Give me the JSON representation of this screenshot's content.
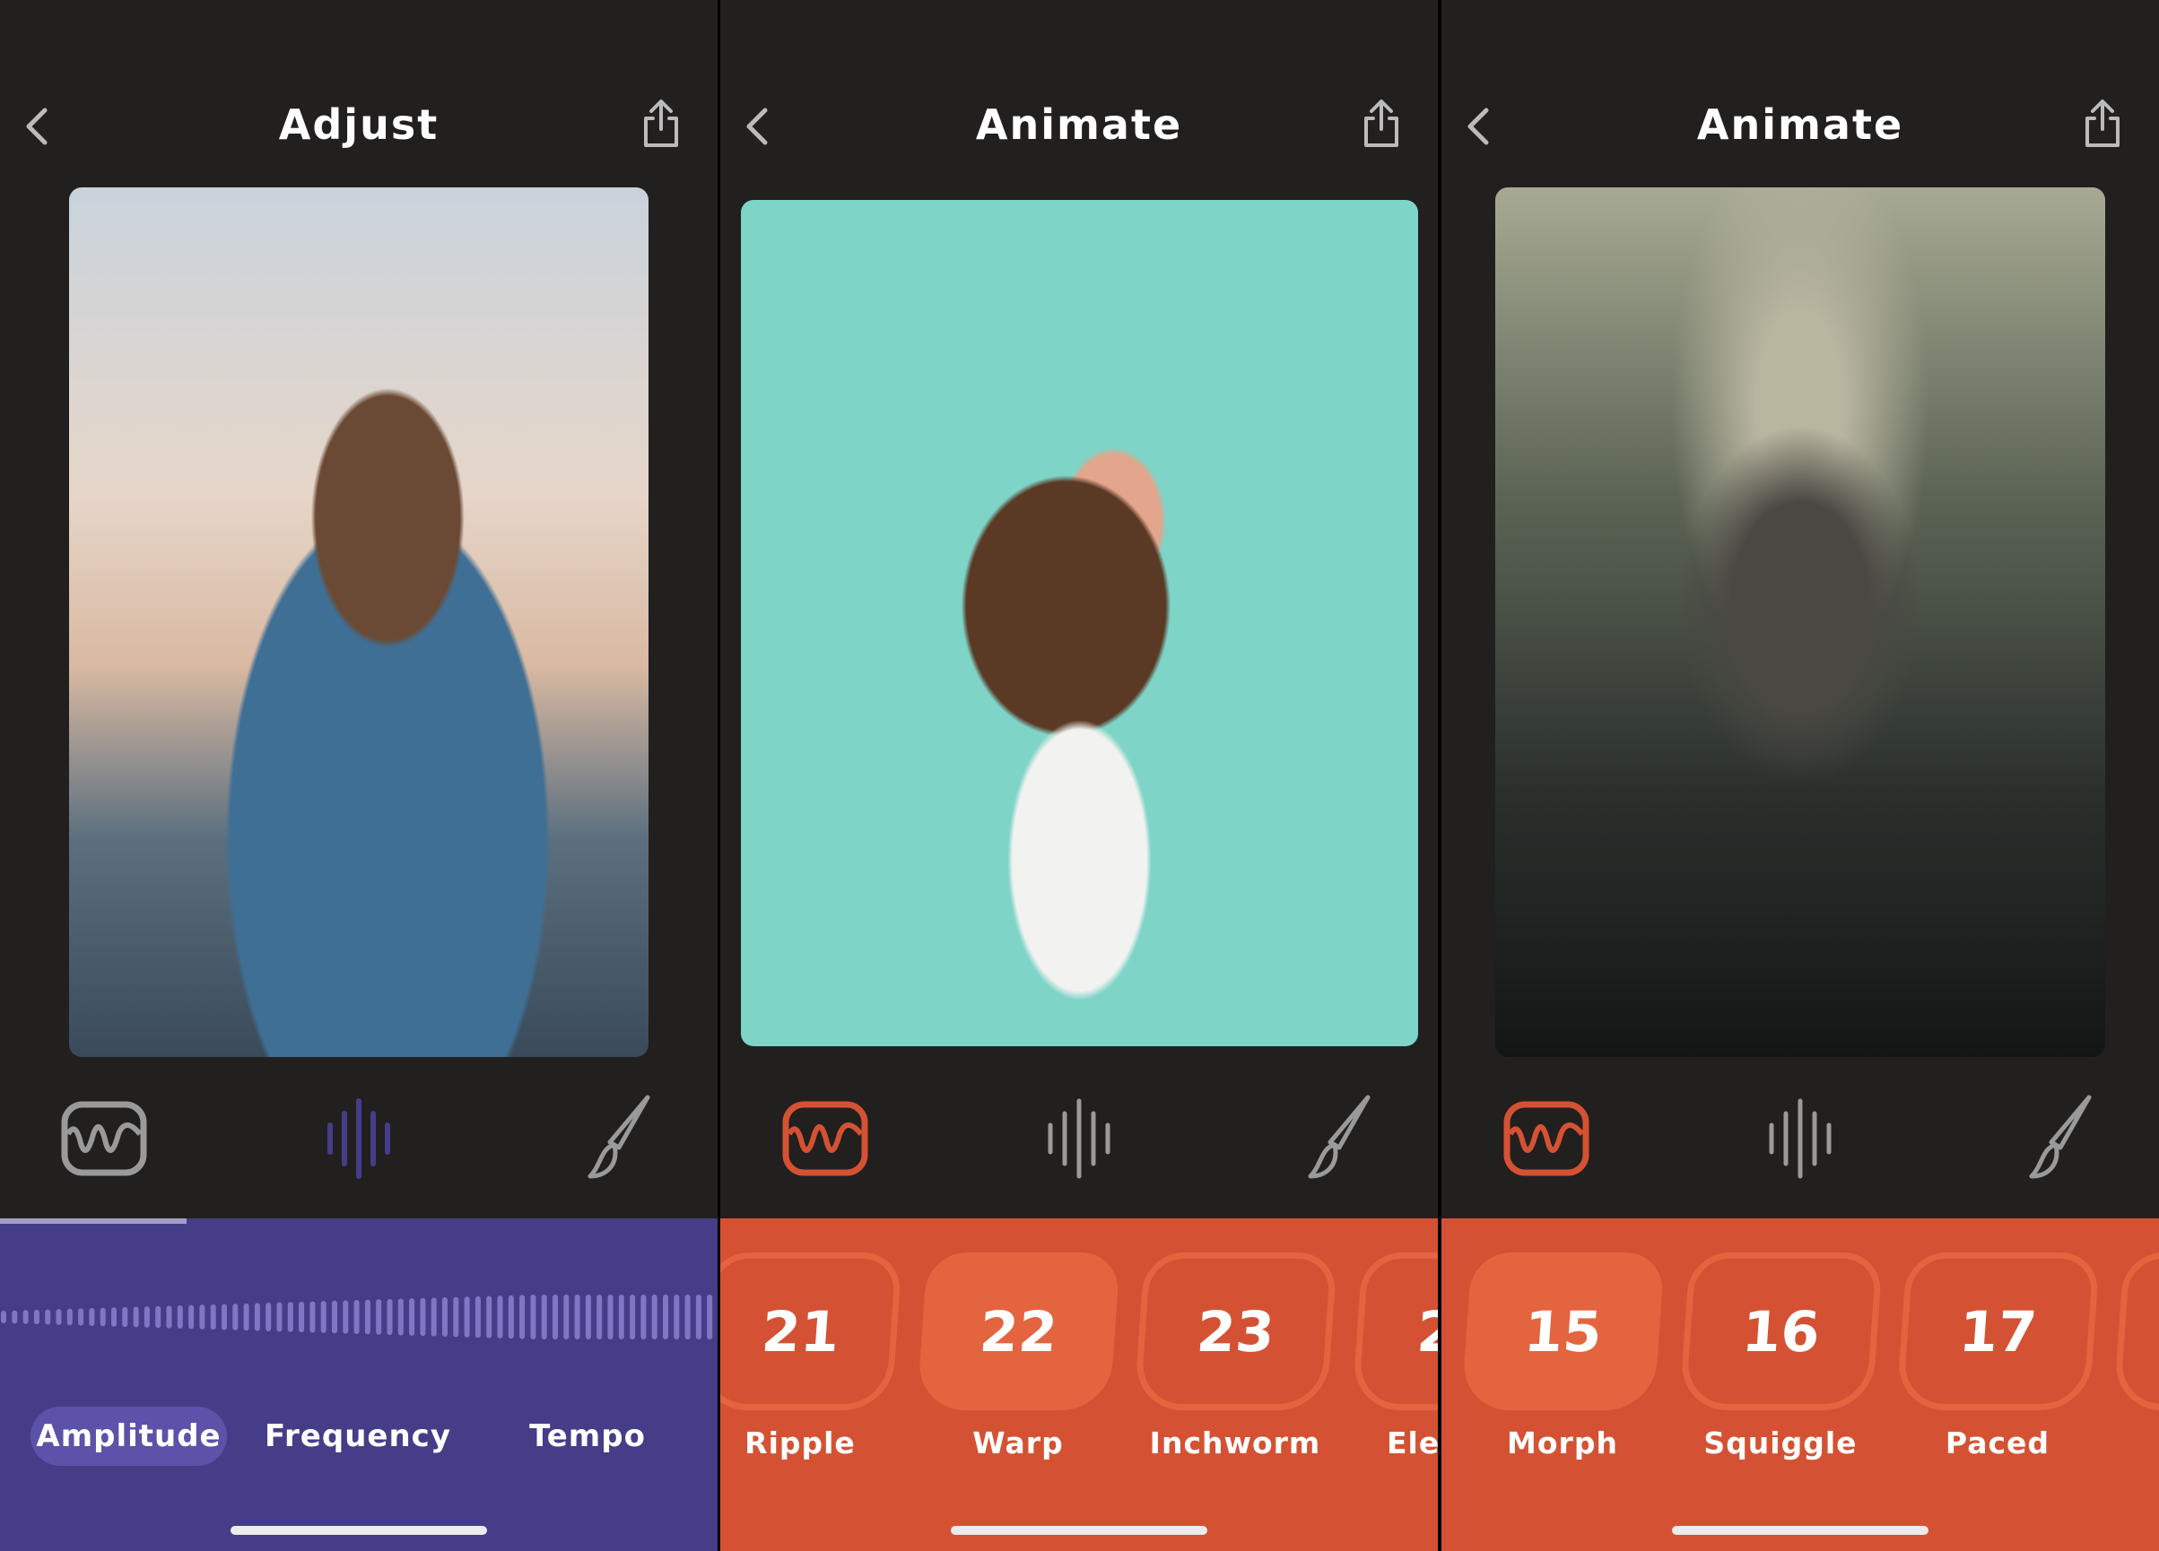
{
  "colors": {
    "dark": "#221f1f",
    "purple": "#463d88",
    "purple_accent": "#5c52a9",
    "orange": "#d45233",
    "orange_accent": "#e4643f",
    "icon_gray": "#9a9a9a"
  },
  "panels": [
    {
      "title": "Adjust",
      "icons": [
        "back-chevron-icon",
        "share-icon"
      ],
      "tools": [
        "wave-frame-icon",
        "audio-bars-icon",
        "paintbrush-icon"
      ],
      "active_tool": "audio-bars-icon",
      "progress": 0.26,
      "tabs": [
        {
          "label": "Amplitude",
          "selected": true
        },
        {
          "label": "Frequency",
          "selected": false
        },
        {
          "label": "Tempo",
          "selected": false
        }
      ]
    },
    {
      "title": "Animate",
      "icons": [
        "back-chevron-icon",
        "share-icon"
      ],
      "tools": [
        "wave-frame-icon",
        "audio-bars-icon",
        "paintbrush-icon"
      ],
      "active_tool": "wave-frame-icon",
      "effects": [
        {
          "number": "21",
          "label": "Ripple",
          "selected": false
        },
        {
          "number": "22",
          "label": "Warp",
          "selected": true
        },
        {
          "number": "23",
          "label": "Inchworm",
          "selected": false
        },
        {
          "number": "2",
          "label": "Ele",
          "selected": false
        }
      ]
    },
    {
      "title": "Animate",
      "icons": [
        "back-chevron-icon",
        "share-icon"
      ],
      "tools": [
        "wave-frame-icon",
        "audio-bars-icon",
        "paintbrush-icon"
      ],
      "active_tool": "wave-frame-icon",
      "effects": [
        {
          "number": "15",
          "label": "Morph",
          "selected": true
        },
        {
          "number": "16",
          "label": "Squiggle",
          "selected": false
        },
        {
          "number": "17",
          "label": "Paced",
          "selected": false
        },
        {
          "number": "",
          "label": "",
          "selected": false
        }
      ]
    }
  ]
}
